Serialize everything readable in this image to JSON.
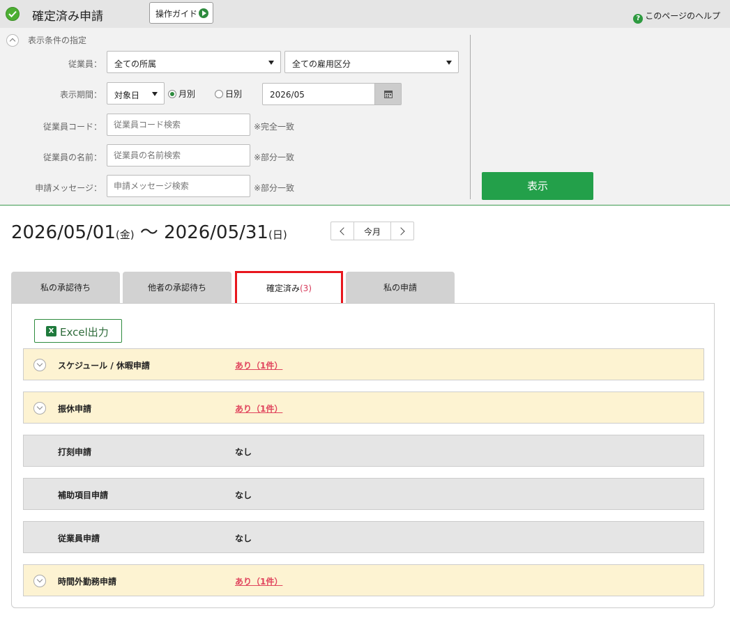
{
  "header": {
    "title": "確定済み申請",
    "guide_label": "操作ガイド",
    "help_label": "このページのヘルプ"
  },
  "filter": {
    "heading": "表示条件の指定",
    "employee_label": "従業員：",
    "department_value": "全ての所属",
    "employment_type_value": "全ての雇用区分",
    "period_label": "表示期間：",
    "period_basis_value": "対象日",
    "radio_monthly": "月別",
    "radio_daily": "日別",
    "date_value": "2026/05",
    "code_label": "従業員コード：",
    "code_placeholder": "従業員コード検索",
    "code_note": "※完全一致",
    "name_label": "従業員の名前：",
    "name_placeholder": "従業員の名前検索",
    "name_note": "※部分一致",
    "message_label": "申請メッセージ：",
    "message_placeholder": "申請メッセージ検索",
    "message_note": "※部分一致",
    "show_button": "表示"
  },
  "period": {
    "start": "2026/05/01",
    "start_dow": "(金)",
    "separator": " 〜 ",
    "end": "2026/05/31",
    "end_dow": "(日)",
    "today_label": "今月"
  },
  "tabs": [
    {
      "label": "私の承認待ち"
    },
    {
      "label": "他者の承認待ち"
    },
    {
      "label": "確定済み",
      "count": "(3)"
    },
    {
      "label": "私の申請"
    }
  ],
  "excel_label": "Excel出力",
  "rows": [
    {
      "name": "スケジュール / 休暇申請",
      "status": "あり（1件）"
    },
    {
      "name": "振休申請",
      "status": "あり（1件）"
    },
    {
      "name": "打刻申請",
      "status": "なし"
    },
    {
      "name": "補助項目申請",
      "status": "なし"
    },
    {
      "name": "従業員申請",
      "status": "なし"
    },
    {
      "name": "時間外勤務申請",
      "status": "あり（1件）"
    }
  ],
  "colors": {
    "accent_green": "#23a04a",
    "highlight_red": "#e8161d",
    "link_pink": "#e0445d",
    "row_has": "#fdf3d2",
    "row_none": "#e5e5e5"
  }
}
